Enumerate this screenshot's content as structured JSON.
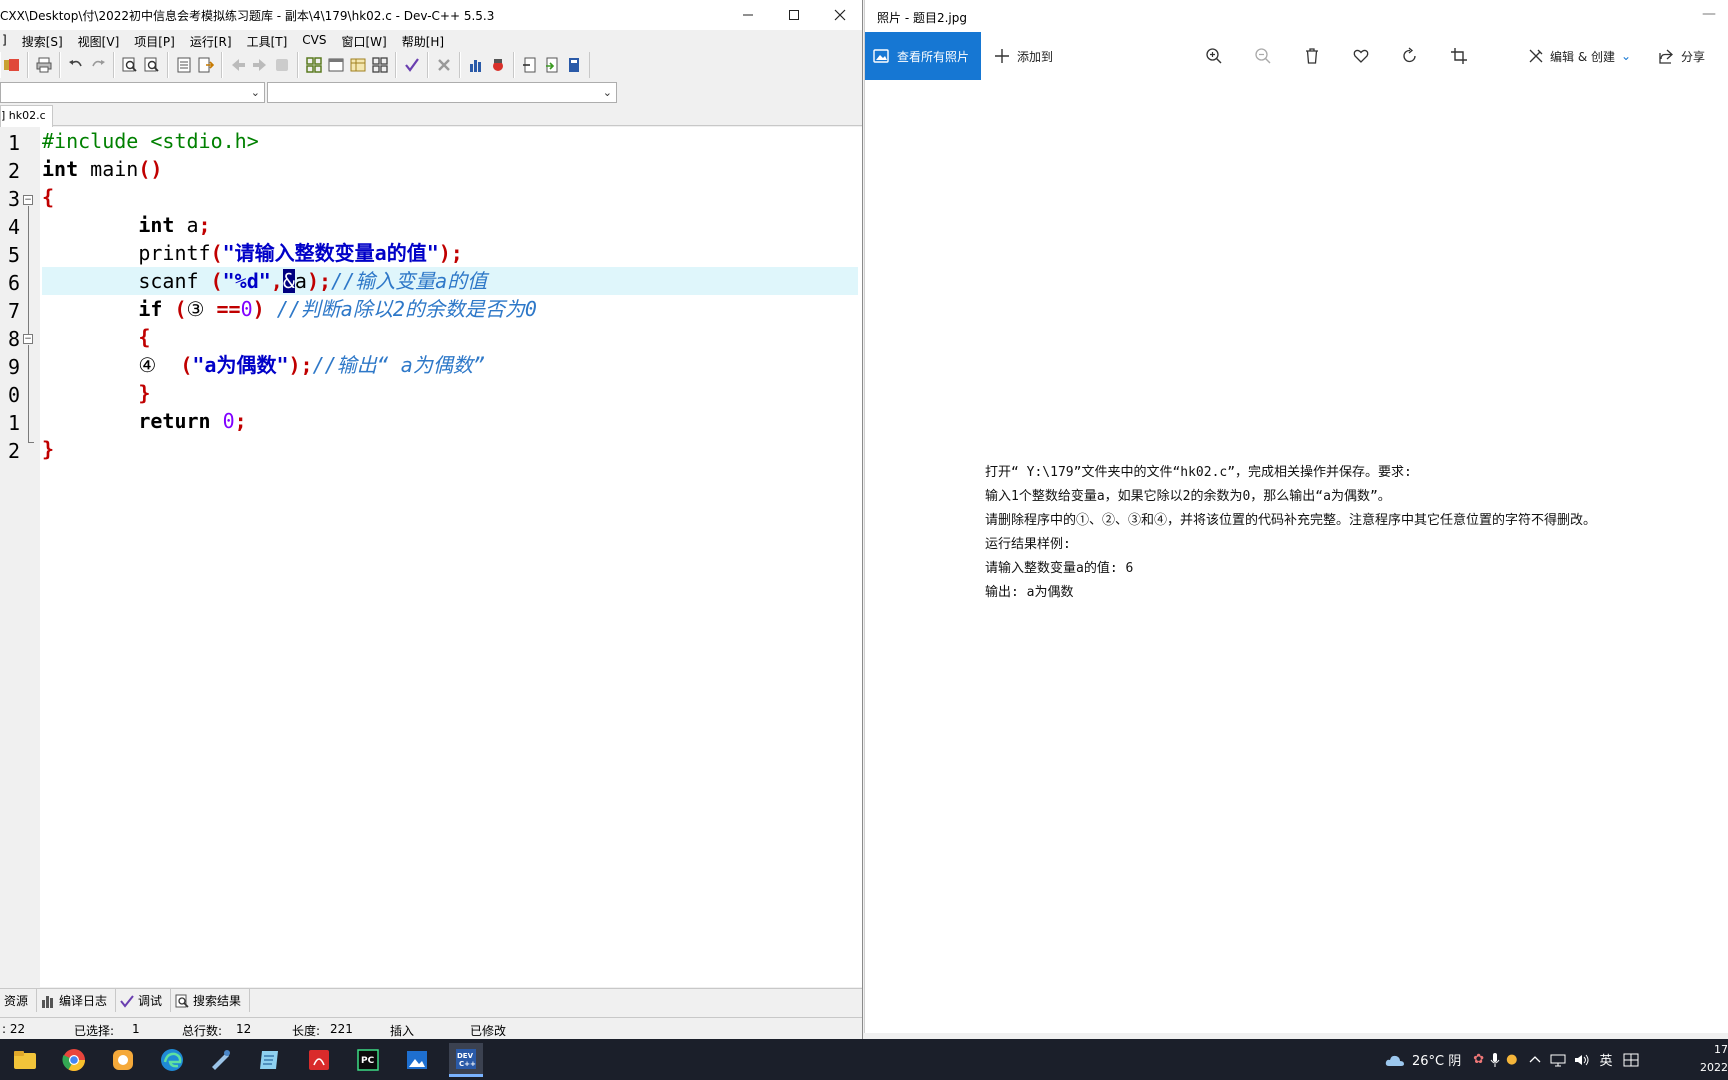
{
  "devcpp": {
    "title": "CXX\\Desktop\\付\\2022初中信息会考模拟练习题库 - 副本\\4\\179\\hk02.c - Dev-C++ 5.5.3",
    "menu": [
      "搜索[S]",
      "视图[V]",
      "项目[P]",
      "运行[R]",
      "工具[T]",
      "CVS",
      "窗口[W]",
      "帮助[H]"
    ],
    "tab_label": "] hk02.c",
    "line_numbers": [
      "1",
      "2",
      "3",
      "4",
      "5",
      "6",
      "7",
      "8",
      "9",
      "0",
      "1",
      "2"
    ],
    "code": {
      "l1_pp": "#include <stdio.h>",
      "l2_kw": "int",
      "l2_rest": " main",
      "l2_sym": "()",
      "l3_sym": "{",
      "l4_kw": "int",
      "l4_rest": " a",
      "l4_sym": ";",
      "l5_id": "printf",
      "l5_sym1": "(",
      "l5_str": "\"请输入整数变量a的值\"",
      "l5_sym2": ");",
      "l6_id": "scanf ",
      "l6_sym1": "(",
      "l6_str": "\"%d\"",
      "l6_comma": ",",
      "l6_sel": "&",
      "l6_a": "a",
      "l6_sym2": ");",
      "l6_cmt": "//输入变量a的值",
      "l7_kw": "if",
      "l7_sym1": " (",
      "l7_mid": "③ ",
      "l7_op": "==",
      "l7_num": "0",
      "l7_sym2": ")",
      "l7_cmt": " //判断a除以2的余数是否为0",
      "l8_sym": "{",
      "l9_mark": "④  ",
      "l9_sym1": "(",
      "l9_str": "\"a为偶数\"",
      "l9_sym2": ");",
      "l9_cmt": "//输出“ a为偶数”",
      "l10_sym": "}",
      "l11_kw": "return",
      "l11_num": " 0",
      "l11_sym": ";",
      "l12_sym": "}"
    },
    "bottom_tabs": [
      "资源",
      "编译日志",
      "调试",
      "搜索结果"
    ],
    "status": {
      "line": ":  22",
      "selected_label": "已选择:",
      "selected_value": "1",
      "total_label": "总行数:",
      "total_value": "12",
      "length_label": "长度:",
      "length_value": "221",
      "mode": "插入",
      "modified": "已修改"
    }
  },
  "photos": {
    "title": "照片 - 题目2.jpg",
    "view_all": "查看所有照片",
    "add_to": "添加到",
    "edit_create": "编辑 & 创建",
    "share": "分享",
    "lines": [
      "打开“ Y:\\179”文件夹中的文件“hk02.c”，完成相关操作并保存。要求:",
      "输入1个整数给变量a，如果它除以2的余数为0，那么输出“a为偶数”。",
      "请删除程序中的①、②、③和④，并将该位置的代码补充完整。注意程序中其它任意位置的字符不得删改。",
      "运行结果样例:",
      "请输入整数变量a的值: 6",
      "输出: a为偶数"
    ]
  },
  "taskbar": {
    "weather": "26°C 阴",
    "ime": "英",
    "clock_time": "17",
    "clock_date": "2022"
  }
}
